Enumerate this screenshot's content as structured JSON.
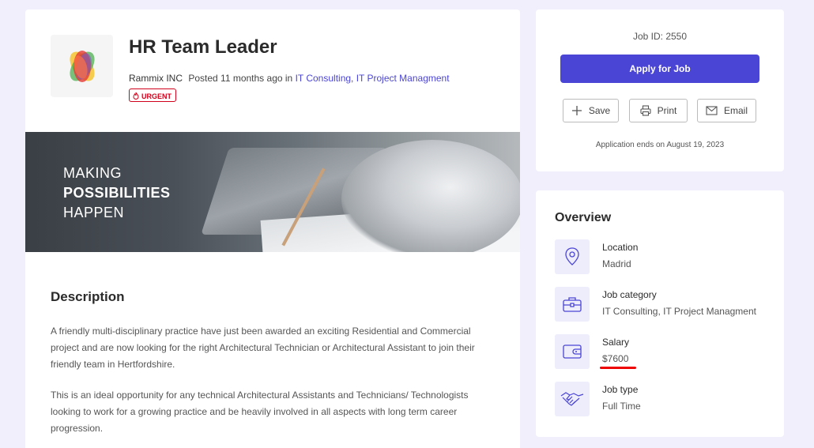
{
  "job": {
    "title": "HR Team Leader",
    "company": "Rammix INC",
    "posted": "Posted 11 months ago in",
    "categories_link": "IT Consulting, IT Project Managment",
    "badge": "URGENT"
  },
  "banner": {
    "line1": "MAKING",
    "line2": "POSSIBILITIES",
    "line3": "HAPPEN"
  },
  "description": {
    "title": "Description",
    "p1": "A friendly multi-disciplinary practice have just been awarded an exciting Residential and Commercial project and are now looking for the right Architectural Technician or Architectural Assistant to join their friendly team in Hertfordshire.",
    "p2": "This is an ideal opportunity for any technical Architectural Assistants and Technicians/ Technologists looking to work for a growing practice and be heavily involved in all aspects with long term career progression."
  },
  "sidebar": {
    "job_id": "Job ID: 2550",
    "apply_label": "Apply for Job",
    "save_label": "Save",
    "print_label": "Print",
    "email_label": "Email",
    "application_ends": "Application ends on August 19, 2023"
  },
  "overview": {
    "title": "Overview",
    "items": [
      {
        "label": "Location",
        "value": "Madrid",
        "icon": "map-pin-icon"
      },
      {
        "label": "Job category",
        "value": "IT Consulting, IT Project Managment",
        "icon": "briefcase-icon"
      },
      {
        "label": "Salary",
        "value": "$7600",
        "icon": "wallet-icon"
      },
      {
        "label": "Job type",
        "value": "Full Time",
        "icon": "handshake-icon"
      }
    ]
  },
  "colors": {
    "accent": "#4b45d6",
    "urgent": "#d0021b",
    "background": "#f0effb"
  }
}
